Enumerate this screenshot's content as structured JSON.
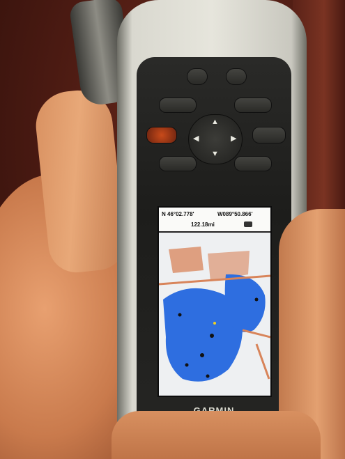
{
  "device": {
    "brand": "GARMIN"
  },
  "screen": {
    "latitude": "N 46°02.778'",
    "longitude": "W089°50.866'",
    "distance": "122.18mi"
  },
  "keypad": {
    "keys": [
      "",
      "",
      "",
      "",
      "",
      "",
      "",
      ""
    ]
  },
  "colors": {
    "water": "#2e6ee0",
    "land": "#f2f2ef",
    "roads": "#d8845a",
    "device_face": "#1f1f1d",
    "power_key": "#c84a1a"
  },
  "icons": {
    "up": "up-arrow-icon",
    "down": "down-arrow-icon",
    "left": "left-arrow-icon",
    "right": "right-arrow-icon"
  }
}
